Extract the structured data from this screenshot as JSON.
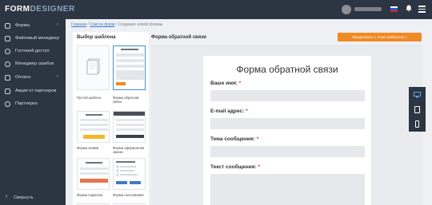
{
  "brand": {
    "logo_part1": "FORM",
    "logo_part2": "DESIGNER"
  },
  "header": {
    "flag_colors": [
      "#ffffff",
      "#2a56c6",
      "#d22c2c"
    ],
    "notification_icon": "bell-icon",
    "menu_icon": "hamburger-icon"
  },
  "sidebar": {
    "items": [
      {
        "label": "Формы",
        "icon": "forms-icon",
        "has_submenu": true,
        "chevron": "‹"
      },
      {
        "label": "Файловый менеджер",
        "icon": "folder-icon",
        "has_submenu": false
      },
      {
        "label": "Гостевой доступ",
        "icon": "user-icon",
        "has_submenu": false
      },
      {
        "label": "Менеджер ошибок",
        "icon": "alert-icon",
        "has_submenu": false
      },
      {
        "label": "Оплата",
        "icon": "payment-icon",
        "has_submenu": true,
        "chevron": "‹"
      },
      {
        "label": "Акции от партнеров",
        "icon": "gift-icon",
        "has_submenu": false
      },
      {
        "label": "Партнерка",
        "icon": "partner-icon",
        "has_submenu": false
      }
    ],
    "collapse_label": "Свернуть",
    "collapse_icon": "‹"
  },
  "breadcrumb": {
    "items": [
      "Главная",
      "Список форм",
      "Создание новой формы"
    ],
    "separator": " / "
  },
  "templates": {
    "title": "Выбор шаблона",
    "items": [
      {
        "caption": "Пустой шаблон",
        "selected": false
      },
      {
        "caption": "Форма обратной связи",
        "selected": true
      },
      {
        "caption": "Форма заявки",
        "selected": false
      },
      {
        "caption": "Форма оформления заказа",
        "selected": false
      },
      {
        "caption": "Форма подписки",
        "selected": false
      },
      {
        "caption": "Форма голосования",
        "selected": false
      }
    ]
  },
  "preview": {
    "title": "Форма обратной связи",
    "continue_button": "Продолжить с этим шаблоном »",
    "form": {
      "heading": "Форма обратной связи",
      "fields": [
        {
          "label": "Ваше имя:",
          "required_mark": "*"
        },
        {
          "label": "E-mail адрес:",
          "required_mark": "*"
        },
        {
          "label": "Тема сообщения:",
          "required_mark": "*"
        },
        {
          "label": "Текст сообщения:",
          "required_mark": "*"
        }
      ]
    }
  },
  "device_toolbar": {
    "items": [
      {
        "icon": "desktop-icon",
        "active": true
      },
      {
        "icon": "tablet-icon",
        "active": false
      },
      {
        "icon": "phone-icon",
        "active": false
      }
    ]
  },
  "colors": {
    "sidebar_bg": "#2c3542",
    "accent_orange": "#f08a24",
    "link_blue": "#3f7bc4",
    "selected_border": "#3f8fd6",
    "required_red": "#d9302c"
  }
}
